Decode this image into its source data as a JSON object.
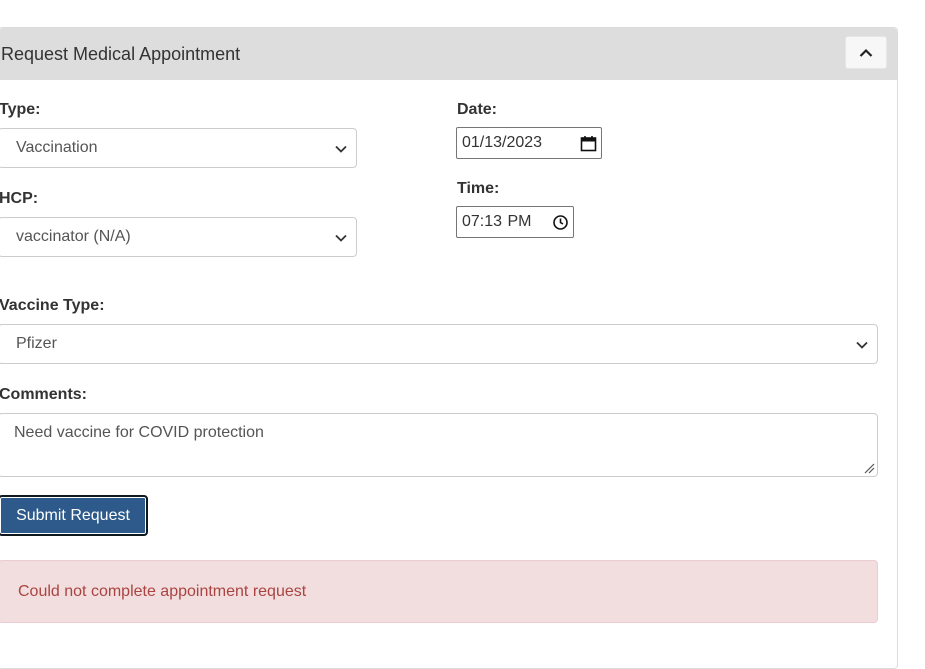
{
  "panel": {
    "title": "Request Medical Appointment",
    "collapse_icon": "chevron-up-icon"
  },
  "form": {
    "type": {
      "label": "Type:",
      "value": "Vaccination"
    },
    "date": {
      "label": "Date:",
      "value": "01/13/2023"
    },
    "hcp": {
      "label": "HCP:",
      "value": "vaccinator (N/A)"
    },
    "time": {
      "label": "Time:",
      "value": "07:13 PM"
    },
    "vaccine_type": {
      "label": "Vaccine Type:",
      "value": "Pfizer"
    },
    "comments": {
      "label": "Comments:",
      "value": "Need vaccine for COVID protection"
    },
    "submit_label": "Submit Request"
  },
  "alert": {
    "message": "Could not complete appointment request",
    "color": "#a94442",
    "background": "#f2dede"
  },
  "colors": {
    "header_bg": "#dddddd",
    "submit_bg": "#2d5a8a"
  }
}
